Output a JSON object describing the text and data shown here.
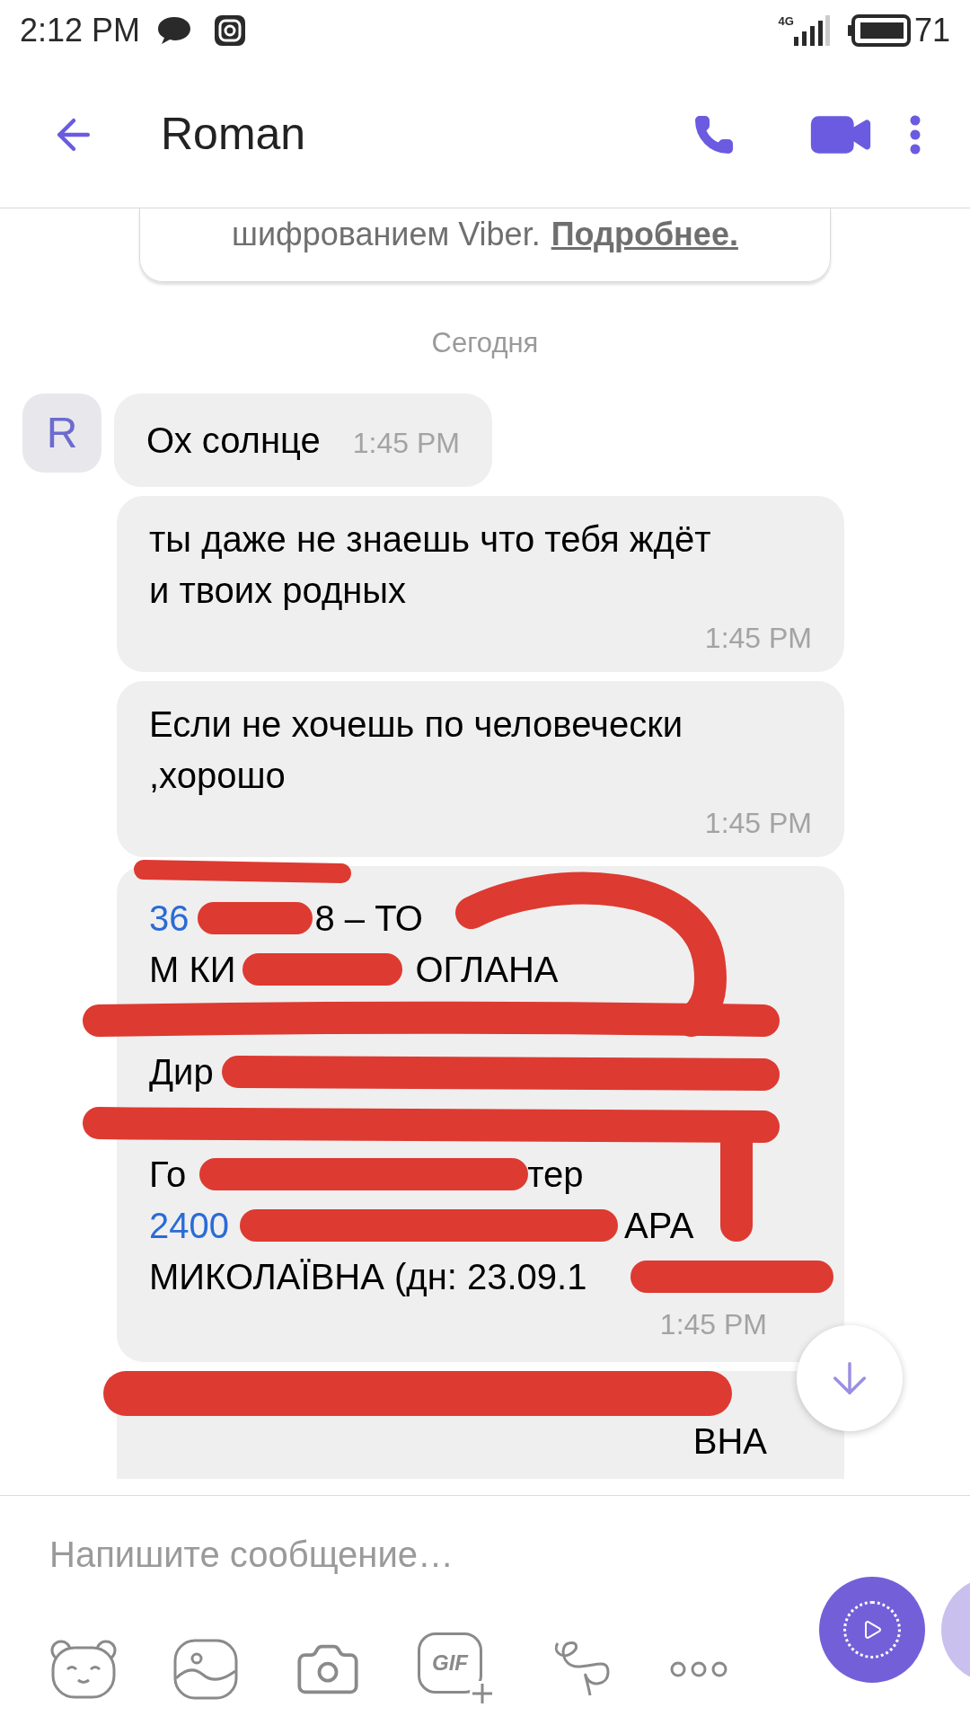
{
  "status_bar": {
    "time": "2:12 PM",
    "network": "4G",
    "battery": "71"
  },
  "header": {
    "title": "Roman"
  },
  "encryption_banner": {
    "text": "шифрованием Viber.",
    "link": "Подробнее."
  },
  "date_divider": "Сегодня",
  "messages": [
    {
      "kind": "first",
      "avatar": "R",
      "text": "Ох солнце",
      "time": "1:45 PM"
    },
    {
      "kind": "text",
      "text": "ты даже не знаешь что тебя ждёт и твоих родных",
      "time": "1:45 PM"
    },
    {
      "kind": "text",
      "text": "Если не хочешь по человечески ,хорошо",
      "time": "1:45 PM"
    },
    {
      "kind": "redacted",
      "lines": [
        [
          {
            "text": "36",
            "link": true
          },
          {
            "text": "8 – ТО",
            "link": false
          }
        ],
        [
          {
            "text": "М КИ",
            "link": false
          },
          {
            "text": "ОГЛАНА",
            "link": false
          }
        ],
        [
          {
            "text": "Дир",
            "link": false
          }
        ],
        [
          {
            "text": "Го",
            "link": false
          },
          {
            "text": "тер",
            "link": false
          }
        ],
        [
          {
            "text": "2400",
            "link": true
          },
          {
            "text": "АРА",
            "link": false
          }
        ],
        [
          {
            "text": "МИКОЛАЇВНА (дн: 23.09.1",
            "link": false
          }
        ]
      ],
      "time": "1:45 PM"
    },
    {
      "kind": "redacted_cut",
      "lines": [
        [
          {
            "text": "ВНА",
            "link": false
          }
        ]
      ]
    }
  ],
  "composer": {
    "placeholder": "Напишите сообщение…",
    "gif_label": "GIF"
  }
}
